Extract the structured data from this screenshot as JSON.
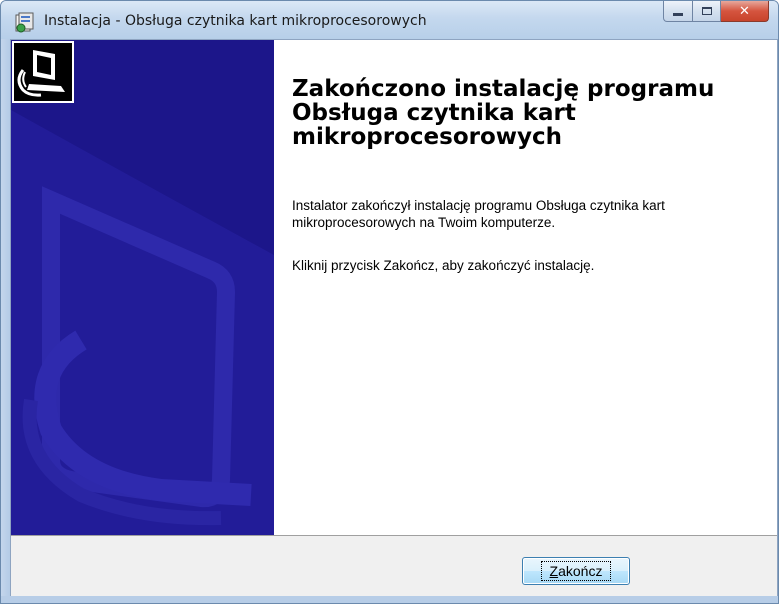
{
  "window": {
    "title": "Instalacja - Obsługa czytnika kart mikroprocesorowych",
    "controls": {
      "minimize": "minimize",
      "maximize": "maximize",
      "close": "x"
    }
  },
  "content": {
    "heading": "Zakończono instalację programu Obsługa czytnika kart mikroprocesorowych",
    "paragraph1": "Instalator zakończył instalację programu Obsługa czytnika kart mikroprocesorowych na Twoim komputerze.",
    "paragraph2": "Kliknij przycisk Zakończ, aby zakończyć instalację."
  },
  "buttons": {
    "finish_accel": "Z",
    "finish_rest": "akończ"
  },
  "colors": {
    "banner": "#1c168a",
    "banner_shape": "#2a24a6",
    "button_border": "#3c7fb1"
  }
}
